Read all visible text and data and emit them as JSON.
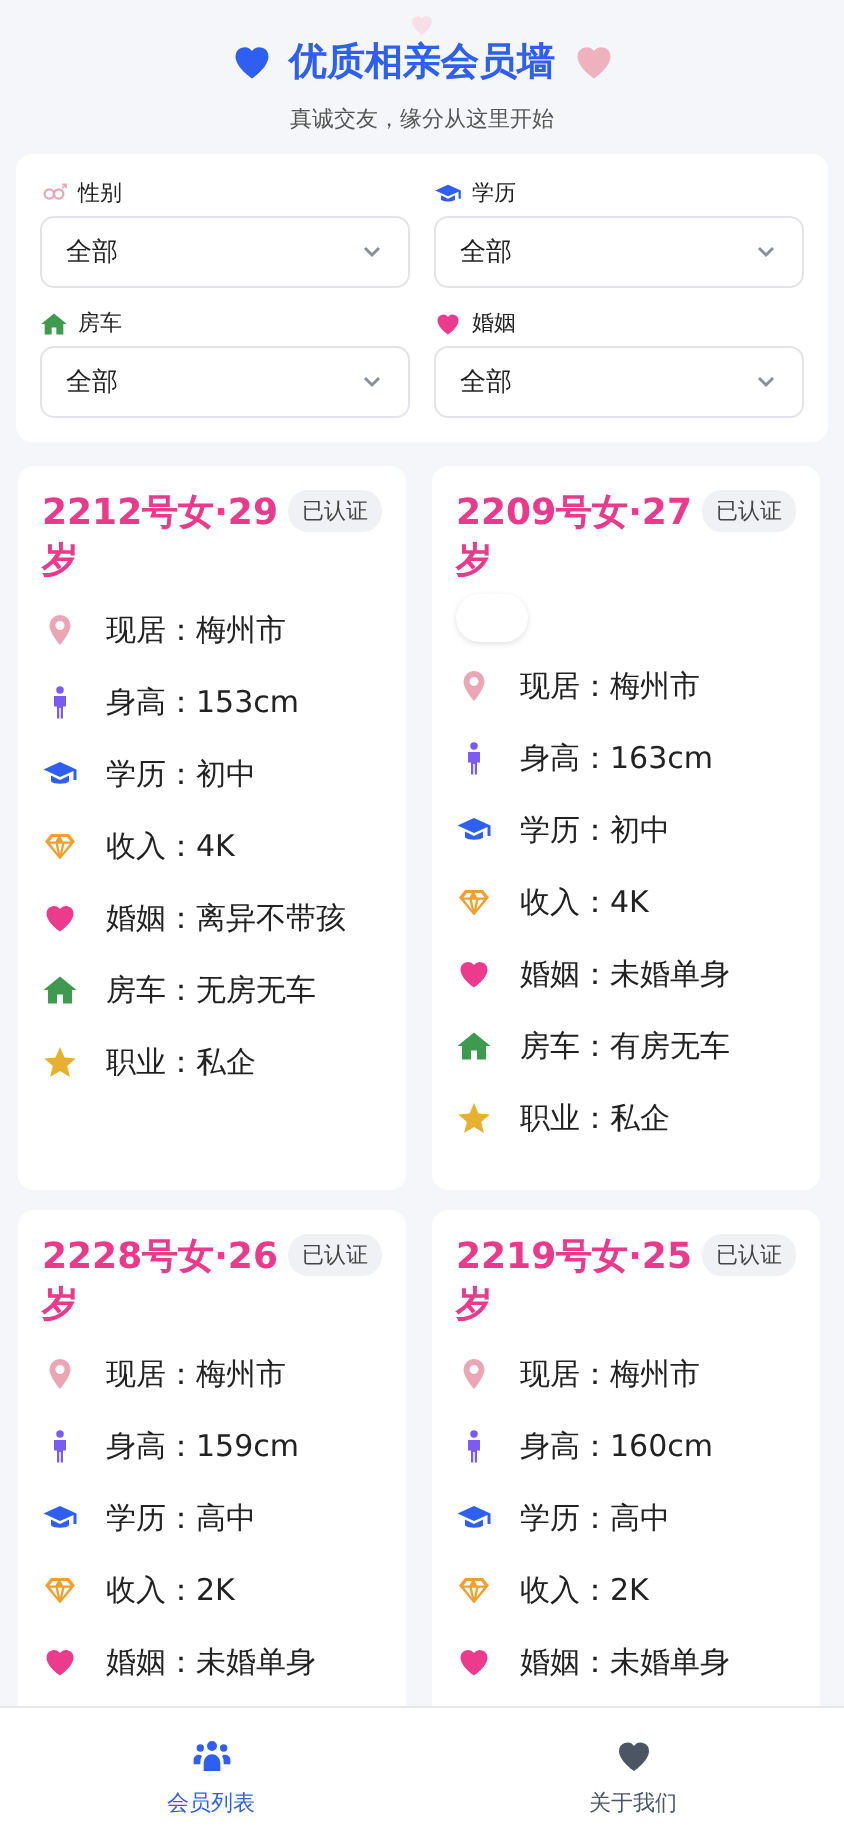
{
  "header": {
    "title": "优质相亲会员墙",
    "subtitle": "真诚交友，缘分从这里开始"
  },
  "filters": [
    {
      "kind": "gender",
      "label": "性别",
      "value": "全部"
    },
    {
      "kind": "education",
      "label": "学历",
      "value": "全部"
    },
    {
      "kind": "house",
      "label": "房车",
      "value": "全部"
    },
    {
      "kind": "marriage",
      "label": "婚姻",
      "value": "全部"
    }
  ],
  "members": [
    {
      "title": "2212号女·29岁",
      "badge": "已认证",
      "empty_tag": false,
      "rows": [
        {
          "kind": "location",
          "text": "现居：梅州市"
        },
        {
          "kind": "height",
          "text": "身高：153cm"
        },
        {
          "kind": "education",
          "text": "学历：初中"
        },
        {
          "kind": "income",
          "text": "收入：4K"
        },
        {
          "kind": "marriage",
          "text": "婚姻：离异不带孩"
        },
        {
          "kind": "house",
          "text": "房车：无房无车"
        },
        {
          "kind": "job",
          "text": "职业：私企"
        }
      ]
    },
    {
      "title": "2209号女·27岁",
      "badge": "已认证",
      "empty_tag": true,
      "rows": [
        {
          "kind": "location",
          "text": "现居：梅州市"
        },
        {
          "kind": "height",
          "text": "身高：163cm"
        },
        {
          "kind": "education",
          "text": "学历：初中"
        },
        {
          "kind": "income",
          "text": "收入：4K"
        },
        {
          "kind": "marriage",
          "text": "婚姻：未婚单身"
        },
        {
          "kind": "house",
          "text": "房车：有房无车"
        },
        {
          "kind": "job",
          "text": "职业：私企"
        }
      ]
    },
    {
      "title": "2228号女·26岁",
      "badge": "已认证",
      "empty_tag": false,
      "rows": [
        {
          "kind": "location",
          "text": "现居：梅州市"
        },
        {
          "kind": "height",
          "text": "身高：159cm"
        },
        {
          "kind": "education",
          "text": "学历：高中"
        },
        {
          "kind": "income",
          "text": "收入：2K"
        },
        {
          "kind": "marriage",
          "text": "婚姻：未婚单身"
        }
      ]
    },
    {
      "title": "2219号女·25岁",
      "badge": "已认证",
      "empty_tag": false,
      "rows": [
        {
          "kind": "location",
          "text": "现居：梅州市"
        },
        {
          "kind": "height",
          "text": "身高：160cm"
        },
        {
          "kind": "education",
          "text": "学历：高中"
        },
        {
          "kind": "income",
          "text": "收入：2K"
        },
        {
          "kind": "marriage",
          "text": "婚姻：未婚单身"
        }
      ]
    }
  ],
  "tabs": [
    {
      "kind": "members",
      "label": "会员列表",
      "selected": true
    },
    {
      "kind": "about",
      "label": "关于我们",
      "selected": false
    }
  ]
}
